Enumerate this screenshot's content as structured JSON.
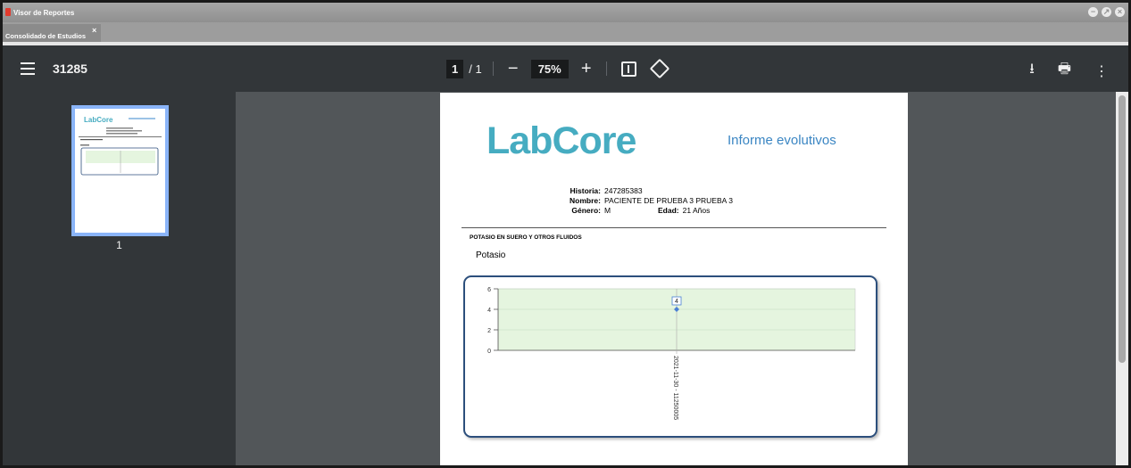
{
  "window": {
    "title": "Visor de Reportes",
    "tab_label": "Consolidado de Estudios",
    "tab_close": "×"
  },
  "toolbar": {
    "document_title": "31285",
    "current_page": "1",
    "page_separator": "/ 1",
    "zoom_out": "−",
    "zoom_level": "75%",
    "zoom_in": "+",
    "download_icon": "⭳",
    "print_icon": "🖶",
    "more_icon": "⋮"
  },
  "sidebar": {
    "thumbnail_number": "1"
  },
  "report": {
    "logo_text": "LabCore",
    "title": "Informe evolutivos",
    "historia_label": "Historia:",
    "historia_value": "247285383",
    "nombre_label": "Nombre:",
    "nombre_value": "PACIENTE DE  PRUEBA 3 PRUEBA 3",
    "genero_label": "Género:",
    "genero_value": "M",
    "edad_label": "Edad:",
    "edad_value": "21 Años",
    "section_title": "POTASIO EN SUERO Y OTROS FLUIDOS",
    "analyte": "Potasio"
  },
  "chart_data": {
    "type": "line",
    "categories": [
      "2021-11-30 - 11250005"
    ],
    "series": [
      {
        "values": [
          4
        ]
      }
    ],
    "data_labels": [
      "4"
    ],
    "ylim": [
      0,
      6
    ],
    "yticks": [
      0,
      2,
      4,
      6
    ],
    "grid": true,
    "plot_band_color": "#e5f5df",
    "point_color": "#4a7fd4"
  },
  "colors": {
    "toolbar_bg": "#323639",
    "viewer_bg": "#525659",
    "logo": "#46acc1",
    "title_blue": "#3b86c3",
    "chart_border": "#2c4f7c",
    "thumb_border": "#8ab4f8"
  }
}
